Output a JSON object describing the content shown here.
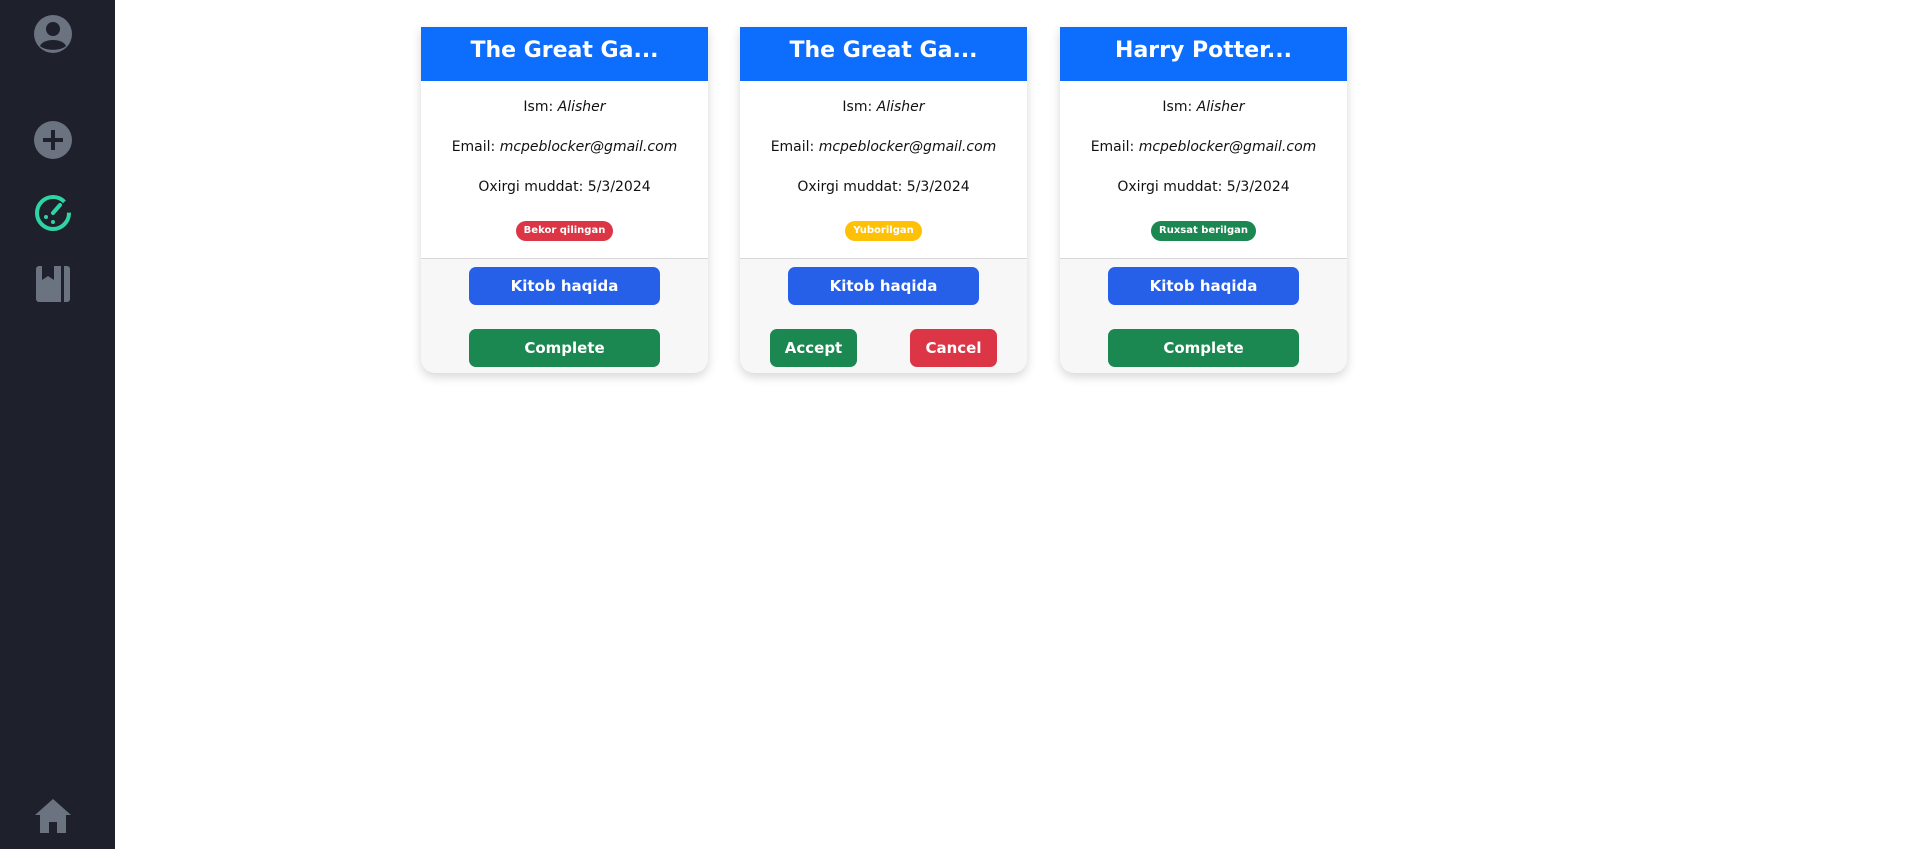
{
  "sidebar": {
    "icons": [
      "user-circle-icon",
      "plus-circle-icon",
      "timer-icon",
      "book-icon",
      "home-icon"
    ],
    "colors": {
      "background": "#1e212b",
      "icon": "#6b7280",
      "active": "#2fd4a3"
    }
  },
  "cards": [
    {
      "title": "The Great Ga...",
      "name_label": "Ism:",
      "name_value": "Alisher",
      "email_label": "Email:",
      "email_value": "mcpeblocker@gmail.com",
      "deadline_label": "Oxirgi muddat:",
      "deadline_value": "5/3/2024",
      "status": "Bekor qilingan",
      "status_color": "#dc3545",
      "about_button": "Kitob haqida",
      "action_buttons": [
        "Complete"
      ]
    },
    {
      "title": "The Great Ga...",
      "name_label": "Ism:",
      "name_value": "Alisher",
      "email_label": "Email:",
      "email_value": "mcpeblocker@gmail.com",
      "deadline_label": "Oxirgi muddat:",
      "deadline_value": "5/3/2024",
      "status": "Yuborilgan",
      "status_color": "#ffc107",
      "about_button": "Kitob haqida",
      "action_buttons": [
        "Accept",
        "Cancel"
      ]
    },
    {
      "title": "Harry Potter...",
      "name_label": "Ism:",
      "name_value": "Alisher",
      "email_label": "Email:",
      "email_value": "mcpeblocker@gmail.com",
      "deadline_label": "Oxirgi muddat:",
      "deadline_value": "5/3/2024",
      "status": "Ruxsat berilgan",
      "status_color": "#1b8751",
      "about_button": "Kitob haqida",
      "action_buttons": [
        "Complete"
      ]
    }
  ]
}
